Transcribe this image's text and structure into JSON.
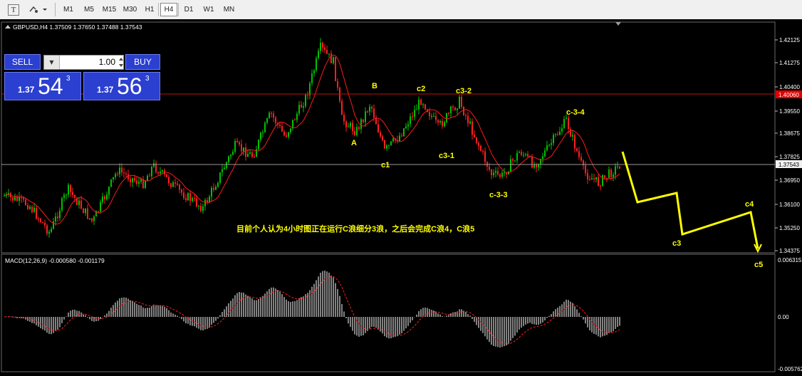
{
  "toolbar": {
    "icons": [
      "text-tool-icon",
      "shapes-tool-icon"
    ],
    "timeframes": [
      "M1",
      "M5",
      "M15",
      "M30",
      "H1",
      "H4",
      "D1",
      "W1",
      "MN"
    ],
    "active_timeframe": "H4"
  },
  "chart": {
    "symbol_header": "GBPUSD,H4  1.37509 1.37650 1.37488 1.37543",
    "price_axis": [
      "1.42125",
      "1.41275",
      "1.40400",
      "1.39550",
      "1.38675",
      "1.37825",
      "1.36950",
      "1.36100",
      "1.35250",
      "1.34375"
    ],
    "current_price_tag": "1.37543",
    "resistance_tag": "1.40060",
    "wave_labels": [
      "A",
      "B",
      "c1",
      "c2",
      "c3-1",
      "c3-2",
      "c3-3",
      "c-3-4",
      "c-3-3",
      "c3",
      "c4",
      "c5"
    ],
    "annotation": "目前个人认为4小时图正在运行C浪细分3浪，之后会完成C浪4，C浪5",
    "colors": {
      "bull": "#00c000",
      "bear": "#ff2020",
      "ma": "#ff1a1a",
      "annotation": "#ffff00",
      "grid": "#303030"
    }
  },
  "trade_panel": {
    "sell_label": "SELL",
    "buy_label": "BUY",
    "lot_value": "1.00",
    "bid_prefix": "1.37",
    "bid_big": "54",
    "bid_sup": "3",
    "ask_prefix": "1.37",
    "ask_big": "56",
    "ask_sup": "3"
  },
  "macd": {
    "header": "MACD(12,26,9) -0.000580 -0.001179",
    "axis": [
      "0.006315",
      "0.00",
      "-0.005762"
    ]
  }
}
